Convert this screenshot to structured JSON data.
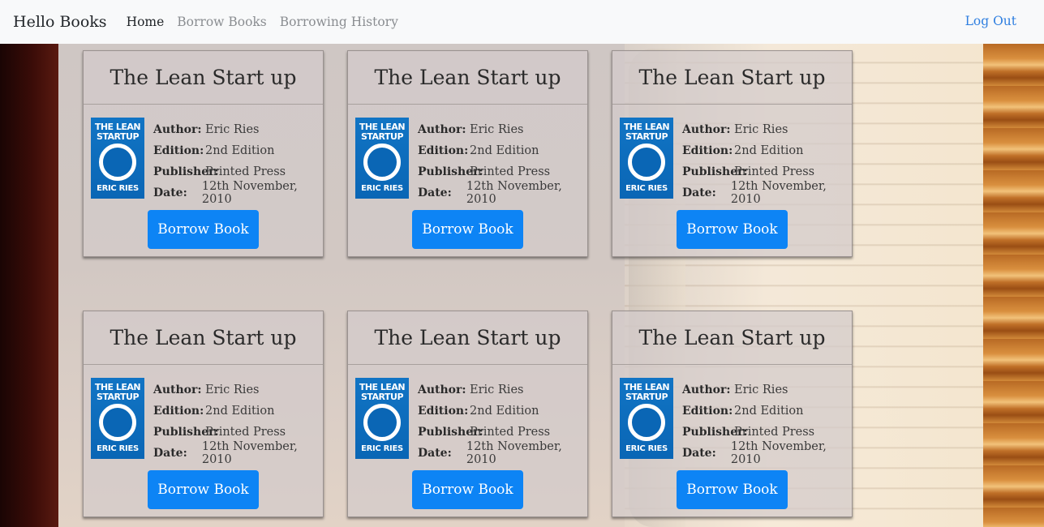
{
  "navbar": {
    "brand": "Hello Books",
    "links": [
      "Home",
      "Borrow Books",
      "Borrowing History"
    ],
    "logout": "Log Out"
  },
  "labels": {
    "author": "Author:",
    "edition": "Edition:",
    "publisher": "Publisher:",
    "date": "Date:",
    "button": "Borrow Book"
  },
  "cover": {
    "title_line1": "THE LEAN",
    "title_line2": "STARTUP",
    "author_line": "ERIC RIES",
    "color": "#0a66b5"
  },
  "books": [
    {
      "title": "The Lean Start up",
      "author": "Eric Ries",
      "edition": "2nd Edition",
      "publisher": "Printed Press",
      "date": "12th November, 2010"
    },
    {
      "title": "The Lean Start up",
      "author": "Eric Ries",
      "edition": "2nd Edition",
      "publisher": "Printed Press",
      "date": "12th November, 2010"
    },
    {
      "title": "The Lean Start up",
      "author": "Eric Ries",
      "edition": "2nd Edition",
      "publisher": "Printed Press",
      "date": "12th November, 2010"
    },
    {
      "title": "The Lean Start up",
      "author": "Eric Ries",
      "edition": "2nd Edition",
      "publisher": "Printed Press",
      "date": "12th November, 2010"
    },
    {
      "title": "The Lean Start up",
      "author": "Eric Ries",
      "edition": "2nd Edition",
      "publisher": "Printed Press",
      "date": "12th November, 2010"
    },
    {
      "title": "The Lean Start up",
      "author": "Eric Ries",
      "edition": "2nd Edition",
      "publisher": "Printed Press",
      "date": "12th November, 2010"
    }
  ],
  "colors": {
    "navbar_bg": "#f8f9fa",
    "button": "#0d84f5",
    "logout_link": "#2f7fe0"
  }
}
